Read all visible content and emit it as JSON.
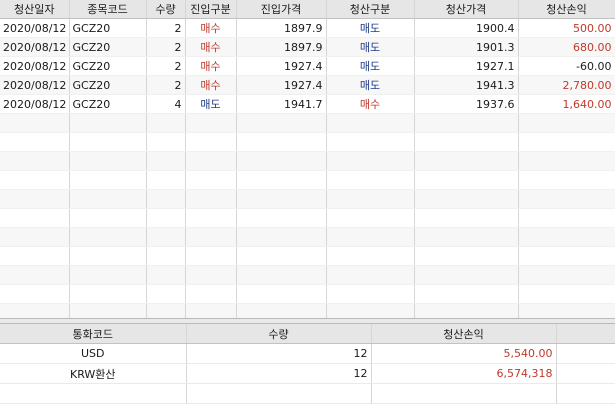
{
  "trades": {
    "headers": [
      "청산일자",
      "종목코드",
      "수량",
      "진입구분",
      "진입가격",
      "청산구분",
      "청산가격",
      "청산손익"
    ],
    "rows": [
      {
        "date": "2020/08/12",
        "code": "GCZ20",
        "qty": "2",
        "entry_type": "매수",
        "entry_price": "1897.9",
        "exit_type": "매도",
        "exit_price": "1900.4",
        "pnl": "500.00"
      },
      {
        "date": "2020/08/12",
        "code": "GCZ20",
        "qty": "2",
        "entry_type": "매수",
        "entry_price": "1897.9",
        "exit_type": "매도",
        "exit_price": "1901.3",
        "pnl": "680.00"
      },
      {
        "date": "2020/08/12",
        "code": "GCZ20",
        "qty": "2",
        "entry_type": "매수",
        "entry_price": "1927.4",
        "exit_type": "매도",
        "exit_price": "1927.1",
        "pnl": "-60.00"
      },
      {
        "date": "2020/08/12",
        "code": "GCZ20",
        "qty": "2",
        "entry_type": "매수",
        "entry_price": "1927.4",
        "exit_type": "매도",
        "exit_price": "1941.3",
        "pnl": "2,780.00"
      },
      {
        "date": "2020/08/12",
        "code": "GCZ20",
        "qty": "4",
        "entry_type": "매도",
        "entry_price": "1941.7",
        "exit_type": "매수",
        "exit_price": "1937.6",
        "pnl": "1,640.00"
      }
    ]
  },
  "summary": {
    "headers": [
      "통화코드",
      "수량",
      "청산손익"
    ],
    "rows": [
      {
        "currency": "USD",
        "qty": "12",
        "pnl": "5,540.00"
      },
      {
        "currency": "KRW환산",
        "qty": "12",
        "pnl": "6,574,318"
      }
    ]
  },
  "colors": {
    "buy": "#c0392b",
    "sell": "#1f3b8a",
    "header_bg": "#e6e6e6"
  }
}
